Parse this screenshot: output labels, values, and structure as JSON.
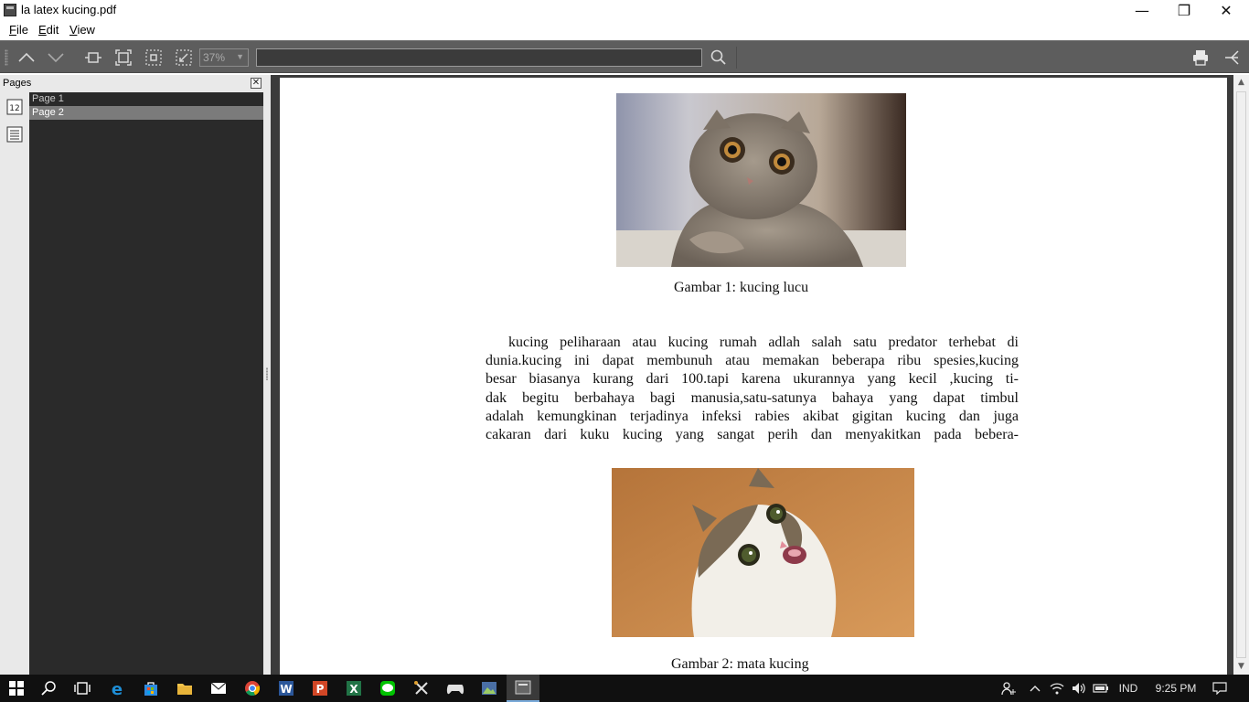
{
  "window": {
    "title": "la latex kucing.pdf",
    "minimize_glyph": "—",
    "restore_glyph": "❐",
    "close_glyph": "✕"
  },
  "menu": {
    "items": [
      {
        "label": "File",
        "mnemonic": "F"
      },
      {
        "label": "Edit",
        "mnemonic": "E"
      },
      {
        "label": "View",
        "mnemonic": "V"
      }
    ]
  },
  "toolbar": {
    "zoom_value": "37%",
    "search_value": "",
    "icons": [
      "page-up-icon",
      "page-down-icon",
      "fit-width-icon",
      "fit-page-icon",
      "actual-size-icon",
      "custom-zoom-icon",
      "search-icon",
      "print-icon",
      "presentation-icon"
    ]
  },
  "sidebar": {
    "title": "Pages",
    "close_glyph": "✕",
    "tabs": [
      "page-thumbnails-icon",
      "outline-icon"
    ],
    "pages": [
      {
        "label": "Page 1",
        "selected": false
      },
      {
        "label": "Page 2",
        "selected": true
      }
    ]
  },
  "document": {
    "figure1_caption": "Gambar 1: kucing lucu",
    "paragraph_lines": [
      "kucing peliharaan atau kucing rumah adlah salah satu predator terhebat di",
      "dunia.kucing ini dapat membunuh atau memakan beberapa ribu spesies,kucing",
      "besar biasanya kurang dari 100.tapi karena ukurannya yang kecil ,kucing ti-",
      "dak begitu berbahaya bagi manusia,satu-satunya bahaya yang dapat timbul",
      "adalah kemungkinan terjadinya infeksi rabies akibat gigitan kucing dan juga",
      "cakaran dari kuku kucing yang sangat perih dan menyakitkan pada bebera-"
    ],
    "figure2_caption": "Gambar 2: mata kucing"
  },
  "taskbar": {
    "apps": [
      "start-icon",
      "search-icon",
      "task-view-icon",
      "edge-icon",
      "store-icon",
      "file-explorer-icon",
      "mail-icon",
      "chrome-icon",
      "word-icon",
      "powerpoint-icon",
      "excel-icon",
      "line-icon",
      "tools-icon",
      "game-icon",
      "photo-app-icon",
      "pdf-viewer-icon"
    ],
    "language": "IND",
    "time": "9:25 PM"
  },
  "colors": {
    "toolbar_bg": "#5d5d5d",
    "page_list_bg": "#2a2a2a",
    "selected_page_bg": "#7b7b7b",
    "taskbar_bg": "#101010"
  }
}
